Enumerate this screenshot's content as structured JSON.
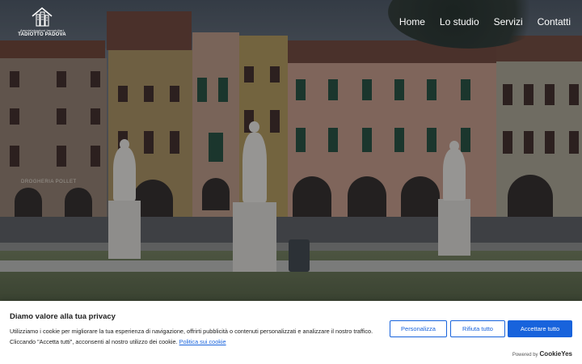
{
  "header": {
    "logo": {
      "tagline": "Amministrazioni Immobiliari",
      "brand": "TADIOTTO PADOVA"
    },
    "nav": [
      {
        "label": "Home"
      },
      {
        "label": "Lo studio"
      },
      {
        "label": "Servizi"
      },
      {
        "label": "Contatti"
      }
    ]
  },
  "hero": {
    "shop_sign": "DROGHERIA POLLET"
  },
  "cookie_banner": {
    "title": "Diamo valore alla tua privacy",
    "text": "Utilizziamo i cookie per migliorare la tua esperienza di navigazione, offrirti pubblicità o contenuti personalizzati e analizzare il nostro traffico. Cliccando \"Accetta tutti\", acconsenti al nostro utilizzo dei cookie.",
    "policy_link": "Politica sui cookie",
    "buttons": {
      "customize": "Personalizza",
      "reject": "Rifiuta tutto",
      "accept": "Accettare tutto"
    },
    "powered_by": "Powered by",
    "powered_brand": "CookieYes",
    "accent_color": "#1863dc"
  }
}
